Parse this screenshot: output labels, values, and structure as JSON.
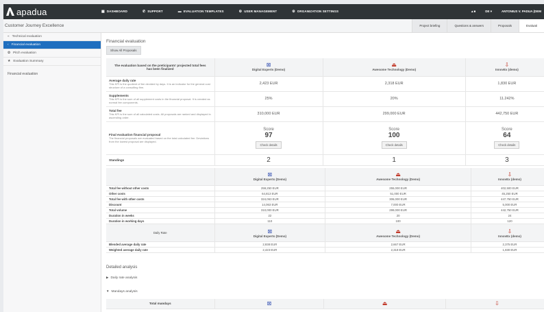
{
  "app": {
    "name": "apadua"
  },
  "nav": {
    "dashboard": "DASHBOARD",
    "support": "SUPPORT",
    "templates": "EVALUATION TEMPLATES",
    "users": "USER MANAGEMENT",
    "org": "ORGANIZATION SETTINGS",
    "lang": "DE ▾",
    "user": "ANTONIUS V. PADUA (DEM"
  },
  "project": {
    "title": "Customer Journey Excellence"
  },
  "subtabs": [
    "Project briefing",
    "Questions & answers",
    "Proposals",
    "Evaluati"
  ],
  "sidebar": {
    "items": [
      {
        "label": "Technical evaluation",
        "icon": "«"
      },
      {
        "label": "Financial evaluation",
        "icon": "‹"
      },
      {
        "label": "Pitch evaluation",
        "icon": "✿"
      },
      {
        "label": "Evaluation Summary",
        "icon": "★"
      }
    ],
    "section": "Financial evaluation"
  },
  "main": {
    "heading": "Financial evaluation",
    "show_all": "Show All Proposals",
    "table_header": "The evaluation based on the preticipants' projected total fees has been finalized",
    "companies": [
      "Digital Experts (Demo)",
      "Awesome Technology (Demo)",
      "InnovEx (demo)"
    ],
    "kpis": [
      {
        "title": "Average daily rate",
        "desc": "This KPI is the quotient of fee devided by days. It is an indicator for the general cost structure of a consulting firm.",
        "values": [
          "2,423 EUR",
          "2,318 EUR",
          "1,830 EUR"
        ]
      },
      {
        "title": "Supplements",
        "desc": "This KPI is the sum of all supplement costs in the financial proposal. It is created as normal fee components.",
        "values": [
          "25%",
          "20%",
          "11.242%"
        ]
      },
      {
        "title": "Total fee",
        "desc": "This KPI is the sum of all calculated costs. All proposals are ranked and displayed in ascending order.",
        "values": [
          "310,000 EUR",
          "299,000 EUR",
          "442,750 EUR"
        ]
      }
    ],
    "final": {
      "title": "Final evaluation financial proposal",
      "desc": "The financial proposals are evaluated based on the total calculated fee. Deviations from the lowest proposal are displayed.",
      "score_label": "Score",
      "scores": [
        "97",
        "100",
        "64"
      ],
      "check": "Check details"
    },
    "standings": {
      "label": "Standings",
      "values": [
        "2",
        "1",
        "3"
      ]
    },
    "cost_rows": [
      {
        "label": "Total fee without other costs",
        "values": [
          "259,250 EUR",
          "255,000 EUR",
          "402,500 EUR"
        ]
      },
      {
        "label": "Other costs",
        "values": [
          "64,813 EUR",
          "51,000 EUR",
          "45,250 EUR"
        ]
      },
      {
        "label": "Total fee with other costs",
        "values": [
          "324,063 EUR",
          "306,000 EUR",
          "447,750 EUR"
        ]
      },
      {
        "label": "Discount",
        "values": [
          "14,063 EUR",
          "7,000 EUR",
          "5,000 EUR"
        ]
      },
      {
        "label": "Total volume",
        "values": [
          "310,000 EUR",
          "299,000 EUR",
          "442,750 EUR"
        ]
      },
      {
        "label": "Duration in weeks",
        "values": [
          "22",
          "20",
          "24"
        ]
      },
      {
        "label": "Duration in working days",
        "values": [
          "110",
          "100",
          "120"
        ]
      }
    ],
    "daily_rate": {
      "header": "Daily Rate",
      "rows": [
        {
          "label": "Blended average daily rate",
          "values": [
            "2,938 EUR",
            "2,667 EUR",
            "2,375 EUR"
          ]
        },
        {
          "label": "Weighted average daily rate",
          "values": [
            "2,423 EUR",
            "2,318 EUR",
            "1,830 EUR"
          ]
        }
      ]
    },
    "detailed": {
      "title": "Detailed analysis",
      "daily_rate_analysis": "Daily rate analysis",
      "mandays_analysis": "Mandays analysis",
      "total_mandays": "Total mandays"
    }
  },
  "colors": {
    "topbar": "#2f3437",
    "accent": "#1f6fbf"
  }
}
